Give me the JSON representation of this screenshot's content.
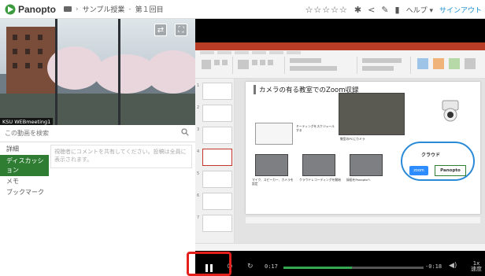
{
  "header": {
    "logo_text": "Panopto",
    "breadcrumb_folder": "サンプル授業",
    "breadcrumb_separator": "›",
    "breadcrumb_session": "第１回目",
    "rating_stars": "☆☆☆☆☆",
    "help_label": "ヘルプ ▾",
    "signin_label": "サインアウト"
  },
  "webcam": {
    "label": "KSU WEBmeeting1"
  },
  "sidebar": {
    "search_placeholder": "この動画を検索",
    "tabs": [
      {
        "label": "詳細"
      },
      {
        "label": "ディスカッション"
      },
      {
        "label": "メモ"
      },
      {
        "label": "ブックマーク"
      }
    ],
    "comment_placeholder": "視聴者にコメントを共有してください。投稿は全員に表示されます。"
  },
  "slide": {
    "title": "カメラの有る教室でのZoom収録",
    "cloud_label": "クラウド",
    "zoom_label": "zoom",
    "panopto_label": "Panopto",
    "captions": [
      "ミーティングをスケジュールする",
      "教室のPCにカメラ",
      "マイク、スピーカー、カメラを設定",
      "クラウドレコーディングを開始",
      "録画をPanoptoへ"
    ]
  },
  "player": {
    "current_time": "0:17",
    "remaining_time": "-0:18",
    "speed_label": "1x",
    "speed_sub": "速度",
    "progress": 0.49
  },
  "colors": {
    "accent_green": "#2e7d32",
    "highlight_red": "#e3201b",
    "ppt_red": "#b83c26",
    "progress_green": "#34a853",
    "link_blue": "#1a8fd1"
  }
}
